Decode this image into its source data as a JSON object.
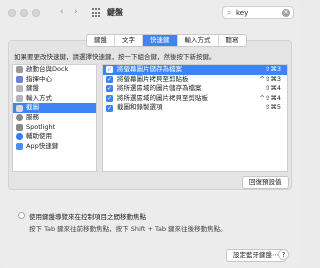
{
  "window": {
    "title": "鍵盤",
    "nav": {
      "back": "‹",
      "forward": "›"
    },
    "search": {
      "value": "key",
      "clear_icon": "✕"
    }
  },
  "tabs": [
    {
      "label": "鍵盤",
      "active": false
    },
    {
      "label": "文字",
      "active": false
    },
    {
      "label": "快速鍵",
      "active": true
    },
    {
      "label": "輸入方式",
      "active": false
    },
    {
      "label": "聽寫",
      "active": false
    }
  ],
  "instructions": "如果要更改快速鍵，請選擇快速鍵，按一下組合鍵，然後按下新按鍵。",
  "categories": [
    {
      "label": "啟動台與Dock",
      "icon": "launchpad-icon",
      "color": "#9a9a9a",
      "selected": false
    },
    {
      "label": "指揮中心",
      "icon": "mission-control-icon",
      "color": "#6f7fd8",
      "selected": false
    },
    {
      "label": "鍵盤",
      "icon": "keyboard-icon",
      "color": "#b5b5b5",
      "selected": false
    },
    {
      "label": "輸入方式",
      "icon": "input-sources-icon",
      "color": "#b5b5b5",
      "selected": false
    },
    {
      "label": "截圖",
      "icon": "screenshot-icon",
      "color": "#d9d9d9",
      "selected": true
    },
    {
      "label": "服務",
      "icon": "gear-icon",
      "color": "#8a8a8a",
      "selected": false
    },
    {
      "label": "Spotlight",
      "icon": "spotlight-icon",
      "color": "#8a8a8a",
      "selected": false
    },
    {
      "label": "輔助使用",
      "icon": "accessibility-icon",
      "color": "#2e7cf6",
      "selected": false
    },
    {
      "label": "App快速鍵",
      "icon": "app-shortcuts-icon",
      "color": "#4a8ef7",
      "selected": false
    }
  ],
  "shortcuts": [
    {
      "label": "將螢幕圖片儲存為檔案",
      "keys": "⇧⌘3",
      "checked": true,
      "selected": true
    },
    {
      "label": "將螢幕圖片拷貝至剪貼板",
      "keys": "^⇧⌘3",
      "checked": true,
      "selected": false
    },
    {
      "label": "將所選區域的圖片儲存為檔案",
      "keys": "⇧⌘4",
      "checked": true,
      "selected": false
    },
    {
      "label": "將所選區域的圖片拷貝至剪貼板",
      "keys": "^⇧⌘4",
      "checked": true,
      "selected": false
    },
    {
      "label": "截圖和錄製選項",
      "keys": "⇧⌘5",
      "checked": true,
      "selected": false
    }
  ],
  "restore_button": "回復預設值",
  "keyboard_nav": {
    "option_label": "使用鍵盤導覽來在控制項目之間移動焦點",
    "description": "按下 Tab 鍵來往前移動焦點，按下 Shift + Tab 鍵來往後移動焦點。"
  },
  "bluetooth_button": "設定藍牙鍵盤⋯",
  "help_button": "?"
}
